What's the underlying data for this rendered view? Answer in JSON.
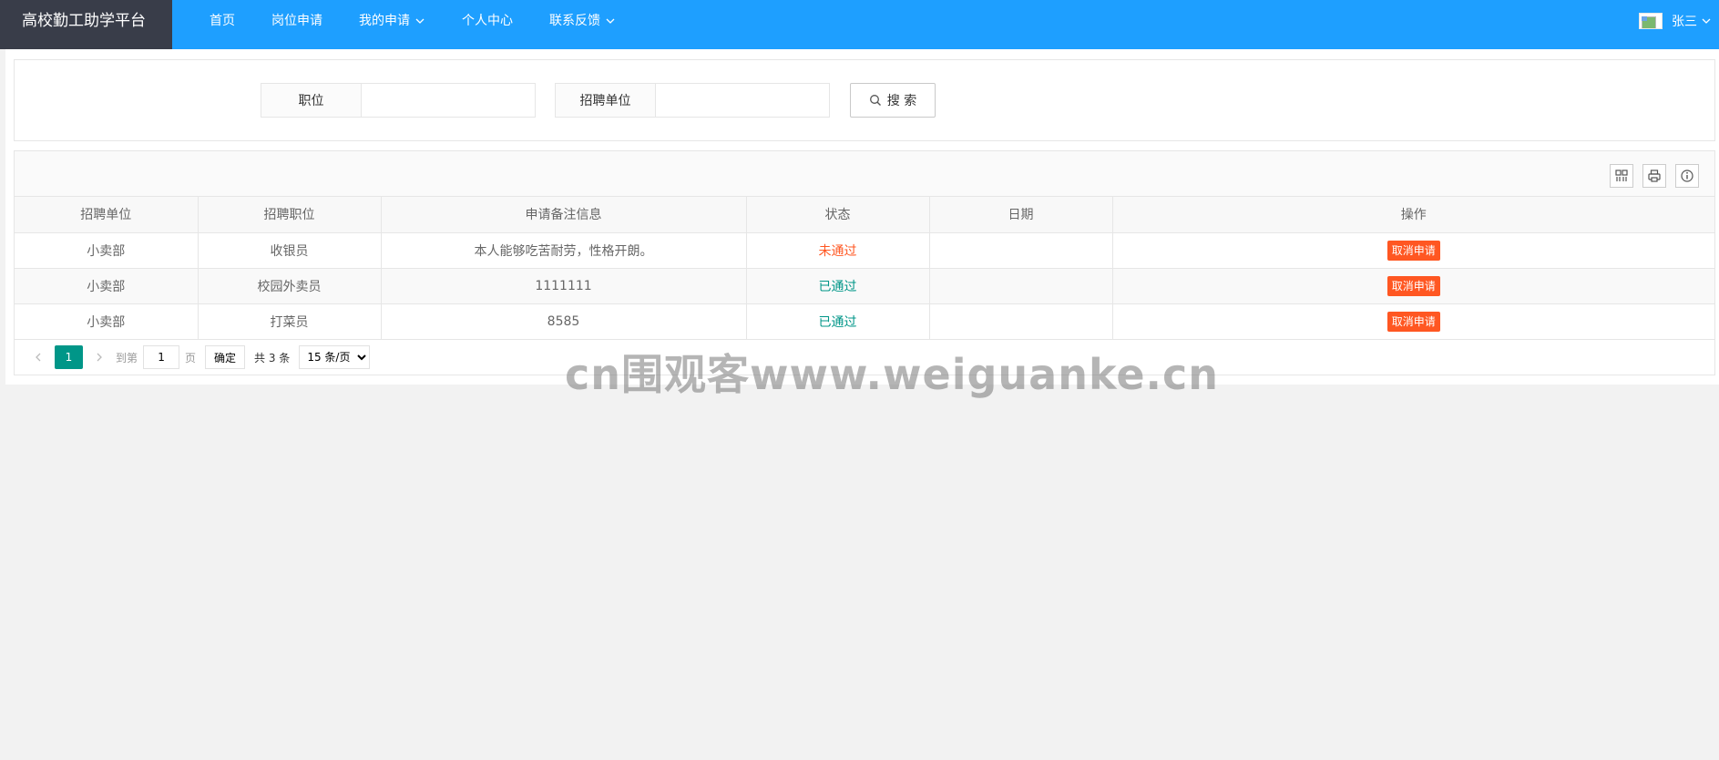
{
  "header": {
    "logo": "高校勤工助学平台",
    "nav": [
      {
        "label": "首页",
        "has_dropdown": false
      },
      {
        "label": "岗位申请",
        "has_dropdown": false
      },
      {
        "label": "我的申请",
        "has_dropdown": true
      },
      {
        "label": "个人中心",
        "has_dropdown": false
      },
      {
        "label": "联系反馈",
        "has_dropdown": true
      }
    ],
    "user": {
      "name": "张三",
      "avatar_icon": "broken-image-icon"
    }
  },
  "search": {
    "position_label": "职位",
    "position_value": "",
    "unit_label": "招聘单位",
    "unit_value": "",
    "button_label": "搜 索",
    "button_icon": "search-icon"
  },
  "toolbar": {
    "icons": [
      "columns-filter-icon",
      "print-icon",
      "info-icon"
    ]
  },
  "table": {
    "columns": [
      "招聘单位",
      "招聘职位",
      "申请备注信息",
      "状态",
      "日期",
      "操作"
    ],
    "rows": [
      {
        "unit": "小卖部",
        "position": "收银员",
        "note": "本人能够吃苦耐劳，性格开朗。",
        "status": "未通过",
        "status_color": "#ff5722",
        "date": "",
        "action": "取消申请"
      },
      {
        "unit": "小卖部",
        "position": "校园外卖员",
        "note": "1111111",
        "status": "已通过",
        "status_color": "#009688",
        "date": "",
        "action": "取消申请"
      },
      {
        "unit": "小卖部",
        "position": "打菜员",
        "note": "8585",
        "status": "已通过",
        "status_color": "#009688",
        "date": "",
        "action": "取消申请"
      }
    ]
  },
  "pager": {
    "current_page": "1",
    "goto_prefix": "到第",
    "goto_value": "1",
    "goto_suffix": "页",
    "confirm_label": "确定",
    "count_text": "共 3 条",
    "page_size": "15 条/页"
  },
  "watermark": "cn围观客www.weiguanke.cn",
  "colors": {
    "header_bg": "#1e9fff",
    "logo_bg": "#393d49",
    "primary": "#009688",
    "danger": "#ff5722"
  }
}
